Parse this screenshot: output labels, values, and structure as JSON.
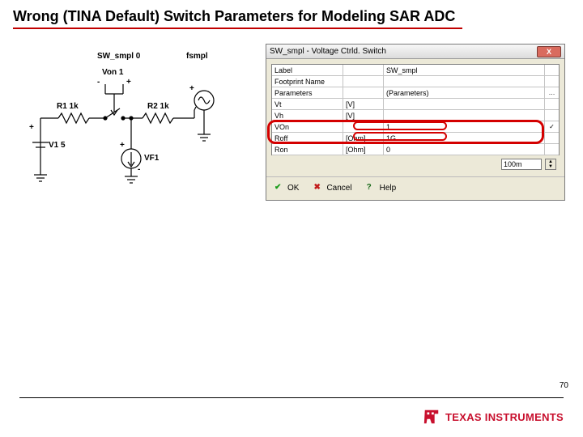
{
  "slide": {
    "title": "Wrong (TINA Default) Switch Parameters for Modeling SAR ADC",
    "page_number": "70"
  },
  "schematic": {
    "sw_label": "SW_smpl 0",
    "fsmpl": "fsmpl",
    "von": "Von 1",
    "r1": "R1 1k",
    "r2": "R2 1k",
    "v1": "V1 5",
    "vf1": "VF1",
    "plus": "+",
    "minus": "-"
  },
  "dialog": {
    "title": "SW_smpl - Voltage Ctrld. Switch",
    "close_glyph": "X",
    "rows": [
      {
        "name": "Label",
        "unit": "",
        "value": "SW_smpl",
        "chk": ""
      },
      {
        "name": "Footprint Name",
        "unit": "",
        "value": "",
        "chk": ""
      },
      {
        "name": "Parameters",
        "unit": "",
        "value": "(Parameters)",
        "chk": "…"
      },
      {
        "name": "Vt",
        "unit": "[V]",
        "value": "",
        "chk": ""
      },
      {
        "name": "Vh",
        "unit": "[V]",
        "value": "",
        "chk": ""
      },
      {
        "name": "VOn",
        "unit": "",
        "value": "1",
        "chk": "✓"
      },
      {
        "name": "Roff",
        "unit": "[Ohm]",
        "value": "1G",
        "chk": ""
      },
      {
        "name": "Ron",
        "unit": "[Ohm]",
        "value": "0",
        "chk": ""
      }
    ],
    "aux_value": "100m",
    "buttons": {
      "ok": "OK",
      "cancel": "Cancel",
      "help": "Help"
    }
  },
  "footer": {
    "brand": "TEXAS INSTRUMENTS"
  }
}
